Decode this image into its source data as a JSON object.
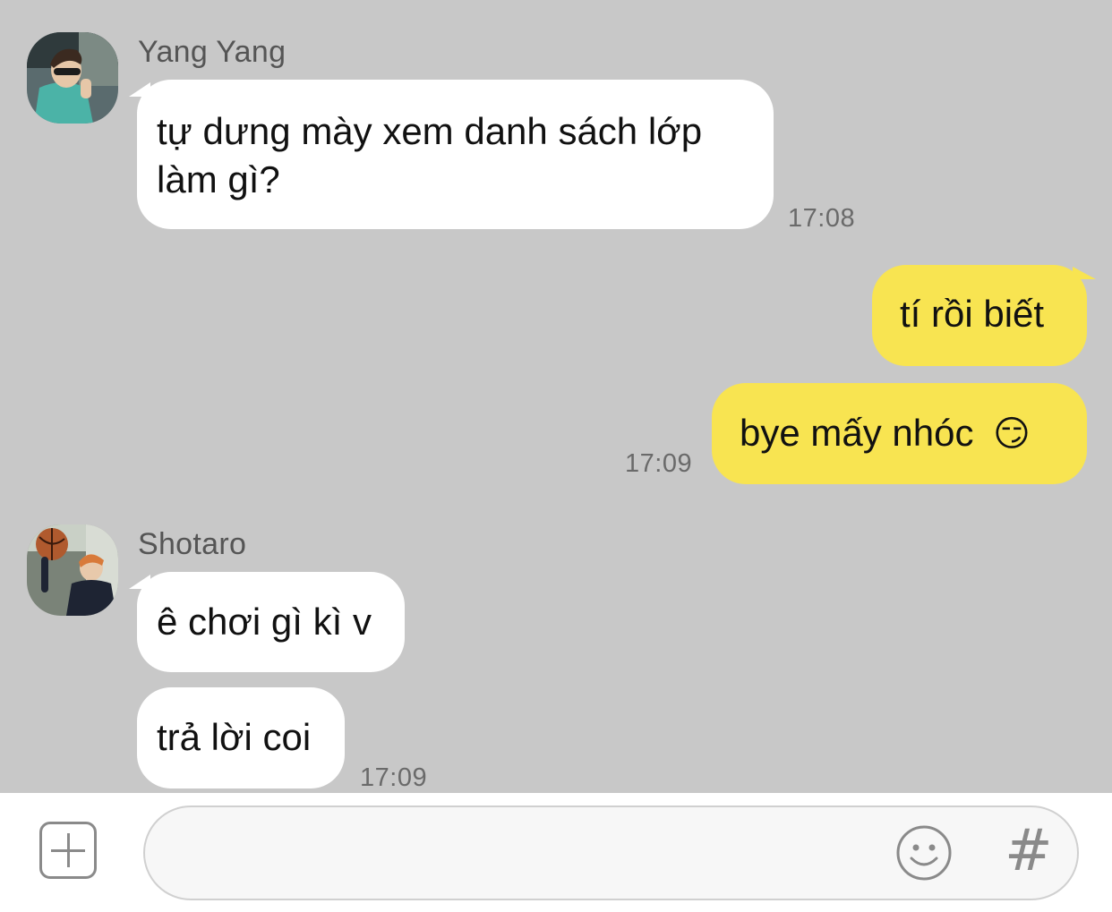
{
  "colors": {
    "chat_background": "#c8c8c8",
    "incoming_bubble": "#ffffff",
    "outgoing_bubble": "#f8e451",
    "timestamp": "#6a6a6a",
    "sender_name": "#555555"
  },
  "messages": [
    {
      "sender": "Yang Yang",
      "avatar_icon": "user-avatar-yang-yang",
      "bubbles": [
        {
          "line1": "tự dưng mày xem danh sách lớp",
          "line2": "làm gì?"
        }
      ],
      "time": "17:08"
    },
    {
      "outgoing": true,
      "bubbles": [
        {
          "text": "tí rồi biết"
        },
        {
          "text": "bye mấy nhóc",
          "emoji": "😏"
        }
      ],
      "time": "17:09"
    },
    {
      "sender": "Shotaro",
      "avatar_icon": "user-avatar-shotaro",
      "bubbles": [
        {
          "text": "ê chơi gì kì v"
        },
        {
          "text": "trả lời coi"
        }
      ],
      "time": "17:09"
    }
  ],
  "input_bar": {
    "add_icon": "plus-square-icon",
    "placeholder": "",
    "emoji_icon": "smiley-icon",
    "hashtag_label": "#"
  }
}
